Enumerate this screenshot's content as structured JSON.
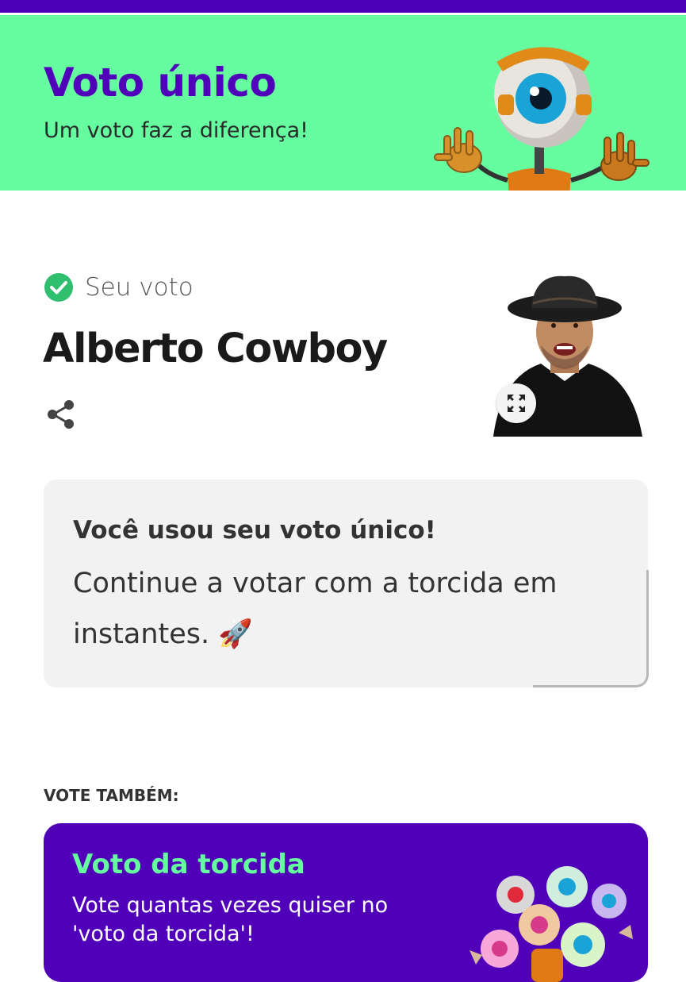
{
  "header": {
    "title": "Voto único",
    "subtitle": "Um voto faz a diferença!",
    "mascot_icon": "eye-mascot-icon",
    "brand_color": "#5000b8",
    "accent_color": "#66fca0"
  },
  "vote": {
    "status_label": "Seu voto",
    "candidate_name": "Alberto Cowboy",
    "status_icon": "check-circle-icon",
    "share_icon": "share-icon",
    "expand_icon": "expand-icon"
  },
  "notice": {
    "title": "Você usou seu voto único!",
    "text": "Continue a votar com a torcida em instantes. 🚀"
  },
  "also": {
    "heading": "VOTE TAMBÉM:",
    "card_title": "Voto da torcida",
    "card_text": "Vote quantas vezes quiser no 'voto da torcida'!"
  }
}
